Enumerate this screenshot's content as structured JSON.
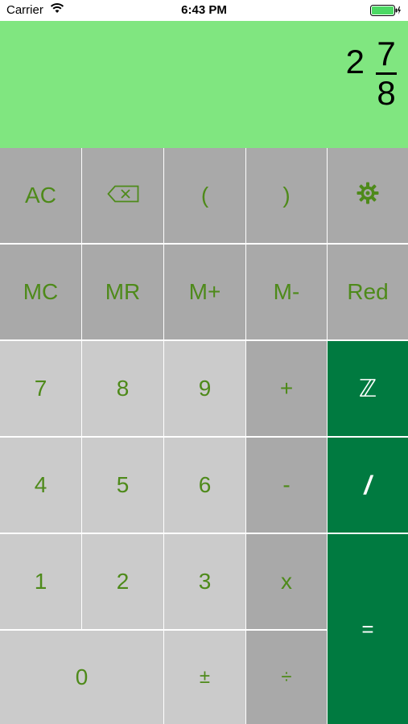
{
  "status_bar": {
    "carrier": "Carrier",
    "time": "6:43 PM",
    "wifi_icon": "wifi-icon",
    "battery_icon": "battery-charging-icon",
    "battery_color": "#4cd964"
  },
  "display": {
    "whole": "2",
    "numerator": "7",
    "denominator": "8",
    "background": "#80e680"
  },
  "keypad": {
    "label_color": "#4e8a1a",
    "colors": {
      "dark": "#a9a9a9",
      "light": "#cbcbcb",
      "green": "#007a40"
    },
    "row1": {
      "ac": "AC",
      "backspace_icon": "backspace-icon",
      "open_paren": "(",
      "close_paren": ")",
      "settings_icon": "gear-icon"
    },
    "row2": {
      "mc": "MC",
      "mr": "MR",
      "mplus": "M+",
      "mminus": "M-",
      "red": "Red"
    },
    "row3": {
      "seven": "7",
      "eight": "8",
      "nine": "9",
      "plus": "+",
      "integer": "ℤ"
    },
    "row4": {
      "four": "4",
      "five": "5",
      "six": "6",
      "minus": "-",
      "fraction": "/"
    },
    "row5": {
      "one": "1",
      "two": "2",
      "three": "3",
      "times": "x",
      "equals": "="
    },
    "row6": {
      "zero": "0",
      "plusminus": "±",
      "divide": "÷"
    }
  }
}
